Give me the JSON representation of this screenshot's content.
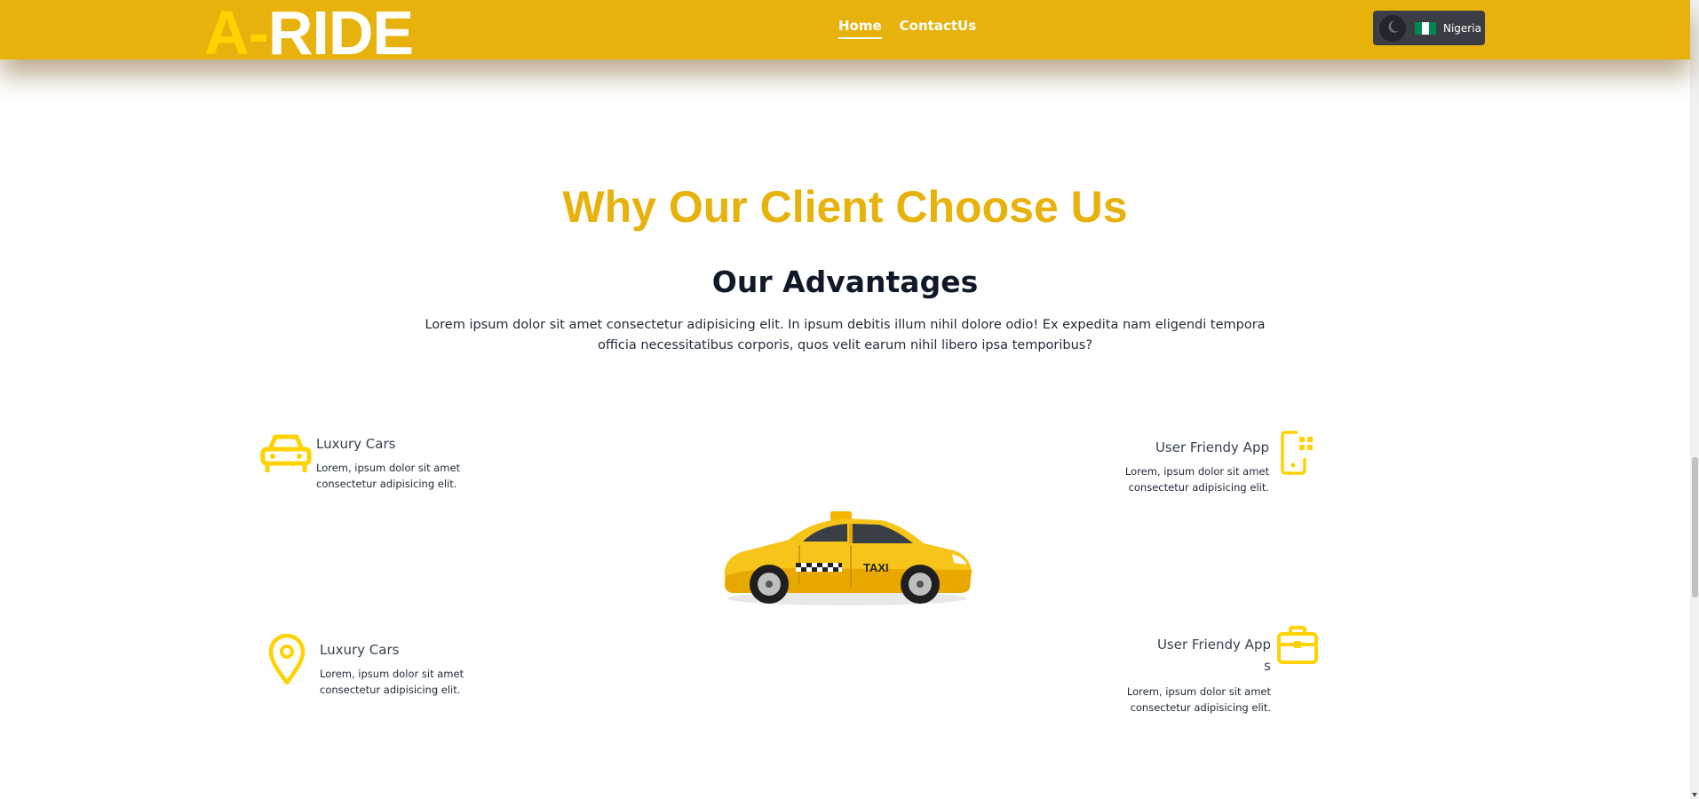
{
  "brand": {
    "part1": "A-",
    "part2": "RIDE"
  },
  "nav": {
    "links": [
      {
        "label": "Home",
        "active": true
      },
      {
        "label": "ContactUs",
        "active": false
      }
    ],
    "region": {
      "label": "Nigeria",
      "flag_colors": [
        "#008751",
        "#ffffff",
        "#008751"
      ]
    },
    "theme_toggle_icon": "moon-icon"
  },
  "section": {
    "eyebrow": "Why Our Client Choose Us",
    "title": "Our Advantages",
    "intro": "Lorem ipsum dolor sit amet consectetur adipisicing elit. In ipsum debitis illum nihil dolore odio! Ex expedita nam eligendi tempora officia necessitatibus corporis, quos velit earum nihil libero ipsa temporibus?"
  },
  "features": [
    {
      "title": "Luxury Cars",
      "desc": "Lorem, ipsum dolor sit amet consectetur adipisicing elit.",
      "icon": "car-icon"
    },
    {
      "title": "User Friendy App",
      "desc": "Lorem, ipsum dolor sit amet consectetur adipisicing elit.",
      "icon": "mobile-app-icon"
    },
    {
      "title": "Luxury Cars",
      "desc": "Lorem, ipsum dolor sit amet consectetur adipisicing elit.",
      "icon": "location-pin-icon"
    },
    {
      "title": "User Friendy App s",
      "desc": "Lorem, ipsum dolor sit amet consectetur adipisicing elit.",
      "icon": "briefcase-icon"
    }
  ],
  "illustration": {
    "taxi_sign": "TAXI"
  },
  "colors": {
    "brand_yellow": "#e8b20c",
    "icon_yellow": "#ffd200",
    "heading_dark": "#111827"
  }
}
